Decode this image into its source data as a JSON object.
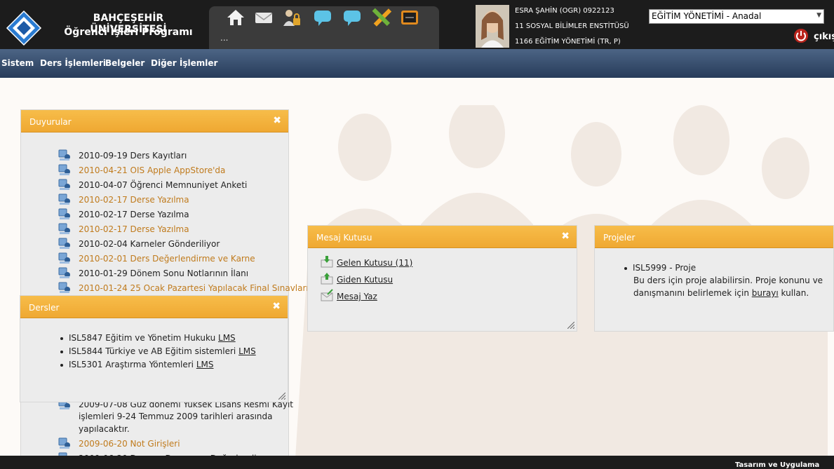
{
  "header": {
    "title_line1": "BAHÇEŞEHİR ÜNİVERSİTESİ",
    "title_line2": "Öğrenci İşleri Programı",
    "toolbar_icons": [
      "home-icon",
      "mail-icon",
      "user-lock-icon",
      "chat-icon",
      "chat-icon",
      "pencil-ruler-icon",
      "notes-icon"
    ],
    "toolbar_more": "...",
    "user": {
      "line1": "ESRA ŞAHİN (OGR) 0922123",
      "line2": "11 SOSYAL BİLİMLER ENSTİTÜSÜ",
      "line3": "1166 EĞİTİM YÖNETİMİ (TR, P)"
    },
    "program_select": "EĞİTİM YÖNETİMİ - Anadal",
    "logout_label": "çıkış"
  },
  "menu": [
    "Sistem",
    "Ders İşlemleri",
    "Belgeler",
    "Diğer İşlemler"
  ],
  "announcements": {
    "title": "Duyurular",
    "items": [
      {
        "date": "2010-09-19",
        "text": "Ders Kayıtları"
      },
      {
        "date": "2010-04-21",
        "text": "OIS Apple AppStore'da"
      },
      {
        "date": "2010-04-07",
        "text": "Öğrenci Memnuniyet Anketi"
      },
      {
        "date": "2010-02-17",
        "text": "Derse Yazılma"
      },
      {
        "date": "2010-02-17",
        "text": "Derse Yazılma"
      },
      {
        "date": "2010-02-17",
        "text": "Derse Yazılma"
      },
      {
        "date": "2010-02-04",
        "text": "Karneler Gönderiliyor"
      },
      {
        "date": "2010-02-01",
        "text": "Ders Değerlendirme ve Karne"
      },
      {
        "date": "2010-01-29",
        "text": "Dönem Sonu Notlarının İlanı"
      },
      {
        "date": "2010-01-24",
        "text": "25 Ocak Pazartesi Yapılacak Final Sınavları"
      }
    ],
    "lower_items": [
      {
        "date": "2009-07-08",
        "text": "Güz dönemi Yüksek Lisans Resmi Kayıt"
      },
      {
        "date": "",
        "text": "işlemleri 9-24 Temmuz 2009 tarihleri arasında"
      },
      {
        "date": "",
        "text": "yapılacaktır."
      },
      {
        "date": "2009-06-20",
        "text": "Not Girişleri"
      },
      {
        "date": "2009-06-20",
        "text": "Ders ve Danışman Değerlendirme"
      }
    ]
  },
  "courses": {
    "title": "Dersler",
    "items": [
      {
        "label": "ISL5847 Eğitim ve Yönetim Hukuku",
        "link": "LMS"
      },
      {
        "label": "ISL5844 Türkiye ve AB Eğitim sistemleri",
        "link": "LMS"
      },
      {
        "label": "ISL5301 Araştırma Yöntemleri",
        "link": "LMS"
      }
    ]
  },
  "messages": {
    "title": "Mesaj Kutusu",
    "items": [
      "Gelen Kutusu (11)",
      "Giden Kutusu",
      "Mesaj Yaz"
    ]
  },
  "projects": {
    "title": "Projeler",
    "item_title": "ISL5999 - Proje",
    "desc_line1": "Bu ders için proje alabilirsin. Proje konunu ve",
    "desc_line2_pre": "danışmanını belirlemek için ",
    "desc_link": "burayı",
    "desc_line2_post": " kullan."
  },
  "footer": {
    "text": "Tasarım ve Uygulama"
  },
  "colors": {
    "panel_header": "#f2ad3a",
    "menu_bar": "#34496a",
    "link_orange": "#c07b1d",
    "header_bg": "#1c1c1c"
  }
}
